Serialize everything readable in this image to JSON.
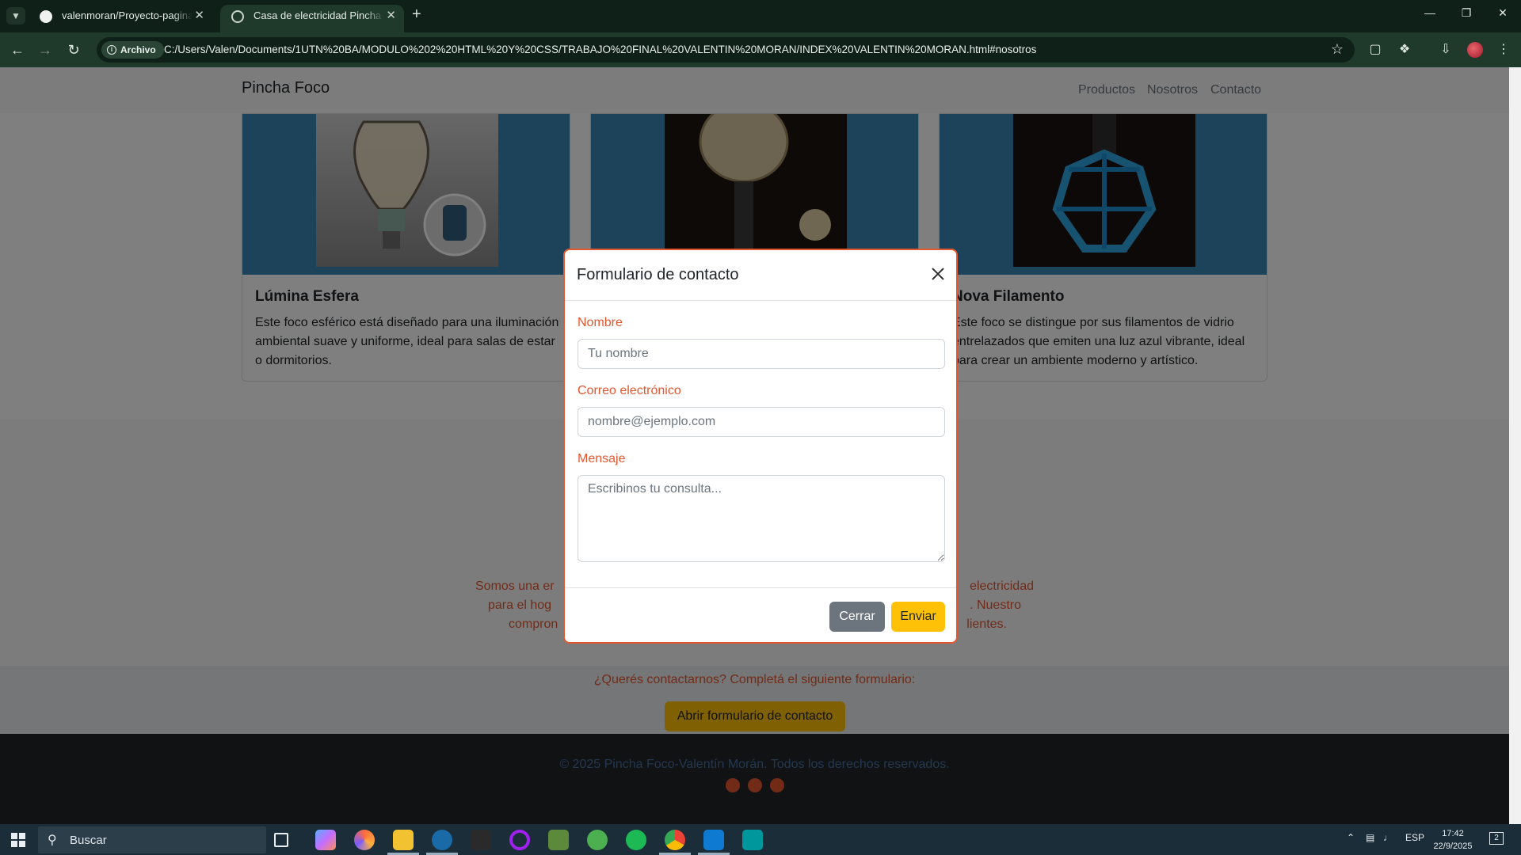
{
  "browser": {
    "tabs": [
      {
        "title": "valenmoran/Proyecto-pagina-d",
        "active": false
      },
      {
        "title": "Casa de electricidad Pincha Foc",
        "active": true
      }
    ],
    "address_chip": "Archivo",
    "url": "C:/Users/Valen/Documents/1UTN%20BA/MODULO%202%20HTML%20Y%20CSS/TRABAJO%20FINAL%20VALENTIN%20MORAN/INDEX%20VALENTIN%20MORAN.html#nosotros"
  },
  "navbar": {
    "brand": "Pincha Foco",
    "links": [
      "Productos",
      "Nosotros",
      "Contacto"
    ]
  },
  "products": [
    {
      "title": "Lúmina Esfera",
      "text": "Este foco esférico está diseñado para una iluminación ambiental suave y uniforme, ideal para salas de estar o dormitorios."
    },
    {
      "title": "",
      "text": ""
    },
    {
      "title": "Nova Filamento",
      "text": "Este foco se distingue por sus filamentos de vidrio entrelazados que emiten una luz azul vibrante, ideal para crear un ambiente moderno y artístico."
    }
  ],
  "about": {
    "text_fragments": [
      "Somos una er",
      "electricidad",
      "para el hog",
      ". Nuestro",
      "compron",
      "lientes."
    ]
  },
  "contact": {
    "prompt": "¿Querés contactarnos? Completá el siguiente formulario:",
    "open_button": "Abrir formulario de contacto"
  },
  "footer": {
    "text": "© 2025 Pincha Foco-Valentín Morán. Todos los derechos reservados.",
    "social_icons": [
      "instagram-icon",
      "facebook-icon",
      "whatsapp-icon"
    ]
  },
  "modal": {
    "title": "Formulario de contacto",
    "fields": {
      "name": {
        "label": "Nombre",
        "placeholder": "Tu nombre",
        "value": ""
      },
      "email": {
        "label": "Correo electrónico",
        "placeholder": "nombre@ejemplo.com",
        "value": ""
      },
      "message": {
        "label": "Mensaje",
        "placeholder": "Escribinos tu consulta...",
        "value": ""
      }
    },
    "buttons": {
      "close": "Cerrar",
      "send": "Enviar"
    }
  },
  "taskbar": {
    "search_placeholder": "Buscar",
    "language": "ESP",
    "time": "17:42",
    "date": "22/9/2025",
    "notifications": "2"
  },
  "colors": {
    "accent": "#e4572e",
    "warning": "#ffc107",
    "secondary": "#6c757d",
    "card_image_bg": "#3b86b7",
    "browser_toolbar": "#1f3a2b"
  }
}
